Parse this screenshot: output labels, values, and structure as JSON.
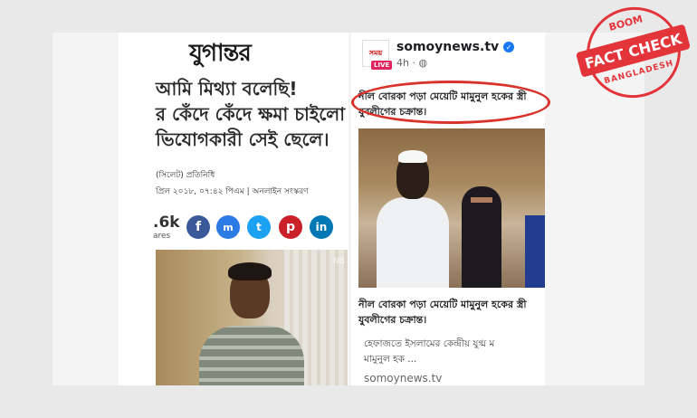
{
  "left": {
    "masthead": "যুগান্তর",
    "headline": [
      "আমি মিথ্যা বলেছি!",
      "র কেঁদে কেঁদে ক্ষমা চাইলো",
      "ভিযোগকারী সেই ছেলে।"
    ],
    "byline": "(সিলেট) প্রতিনিধি",
    "dateline": "প্রিল ২০১৮, ০৭:৪২ পিএম  |  অনলাইন সংস্করণ",
    "share_count": ".6k",
    "share_label": "ares",
    "share_buttons": [
      "f",
      "m",
      "t",
      "p",
      "in"
    ],
    "watermark": "NB"
  },
  "right": {
    "avatar_text": "সময়",
    "live_label": "LIVE",
    "page_name": "somoynews.tv",
    "post_time": "4h · ",
    "post_text": [
      "নীল বোরকা পড়া মেয়েটি মামুনুল হকের স্ত্রী",
      "যুবলীগের চক্রান্ত।"
    ],
    "link_title": [
      "নীল বোরকা পড়া মেয়েটি মামুনুল হকের স্ত্রী",
      "যুবলীগের চক্রান্ত।"
    ],
    "link_desc": [
      "হেফাজতে ইসলামের কেন্দ্রীয় যুগ্ম ম",
      "মামুনুল হক ..."
    ],
    "link_domain": "somoynews.tv"
  },
  "stamp": {
    "top": "BOOM",
    "band": "FACT CHECK",
    "bottom": "BANGLADESH"
  },
  "colors": {
    "stamp_red": "#e3343a",
    "facebook_blue": "#1877f2",
    "highlight_red": "#d9322b"
  }
}
